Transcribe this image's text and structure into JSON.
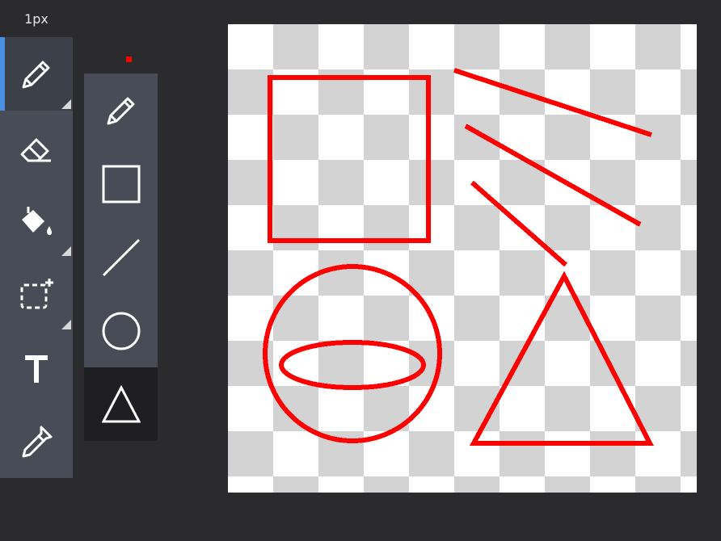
{
  "toolbar": {
    "brush_size": "1px",
    "tools": [
      {
        "name": "pencil",
        "icon": "pencil-icon",
        "selected": true,
        "has_submenu": true
      },
      {
        "name": "eraser",
        "icon": "eraser-icon",
        "selected": false,
        "has_submenu": false
      },
      {
        "name": "fill",
        "icon": "paint-bucket-icon",
        "selected": false,
        "has_submenu": true
      },
      {
        "name": "select",
        "icon": "selection-add-icon",
        "selected": false,
        "has_submenu": true
      },
      {
        "name": "text",
        "icon": "text-icon",
        "selected": false,
        "has_submenu": false
      },
      {
        "name": "eyedropper",
        "icon": "eyedropper-icon",
        "selected": false,
        "has_submenu": false
      }
    ]
  },
  "current_color": "#ff0000",
  "shape_flyout": {
    "options": [
      {
        "name": "pencil",
        "icon": "pencil-icon"
      },
      {
        "name": "rectangle",
        "icon": "rectangle-icon"
      },
      {
        "name": "line",
        "icon": "line-icon"
      },
      {
        "name": "circle",
        "icon": "circle-icon"
      },
      {
        "name": "triangle",
        "icon": "triangle-icon",
        "active": true
      }
    ]
  },
  "colors": {
    "accent": "#4a90e2",
    "stroke": "#ff0000",
    "panel": "#474c56",
    "background": "#2b2b2e"
  }
}
